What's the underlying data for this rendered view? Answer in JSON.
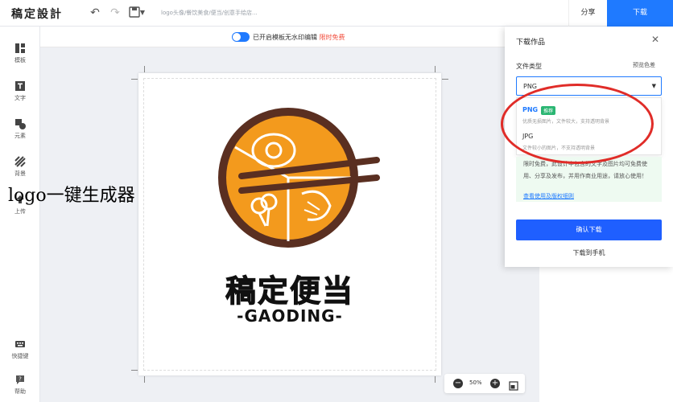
{
  "topbar": {
    "brand": "稿定設計",
    "title_placeholder": "logo头像/餐饮美食/便当/创意手绘店...",
    "share_label": "分享",
    "download_label": "下载"
  },
  "sidebar": {
    "items": [
      {
        "label": "模板",
        "icon": "template-icon"
      },
      {
        "label": "文字",
        "icon": "text-icon"
      },
      {
        "label": "元素",
        "icon": "elements-icon"
      },
      {
        "label": "背景",
        "icon": "background-icon"
      },
      {
        "label": "上传",
        "icon": "upload-icon"
      }
    ],
    "bottom_items": [
      {
        "label": "快捷键",
        "icon": "keyboard-icon"
      },
      {
        "label": "帮助",
        "icon": "help-icon"
      }
    ]
  },
  "watermark": {
    "text": "已开启模板无水印编辑",
    "free_label": "限时免费"
  },
  "artboard": {
    "logo_title": "稿定便当",
    "logo_subtitle": "-GAODING-"
  },
  "zoom": {
    "value": "50%"
  },
  "overlay": {
    "text": "logo一键生成器"
  },
  "download_panel": {
    "title": "下载作品",
    "file_type_label": "文件类型",
    "preview_color_label": "预览色差",
    "selected_value": "PNG",
    "options": [
      {
        "name": "PNG",
        "badge": "推荐",
        "desc": "优质无损图片，文件较大，支持透明背景"
      },
      {
        "name": "JPG",
        "badge": "",
        "desc": "文件较小的图片，不支持透明背景"
      }
    ],
    "info_lines": [
      "限时免费，此设计中包含的文字及图片均可免费使",
      "用、分享及发布，并用作商业用途，请放心使用！"
    ],
    "info_link": "查看使用及版权细则",
    "confirm_label": "确认下载",
    "phone_label": "下载到手机"
  },
  "colors": {
    "accent": "#1f7aff",
    "free": "#f24b3a",
    "badge": "#2bb673",
    "logo_orange": "#f39a1d",
    "logo_brown": "#5a2f21",
    "annotation_red": "#e02c28"
  }
}
